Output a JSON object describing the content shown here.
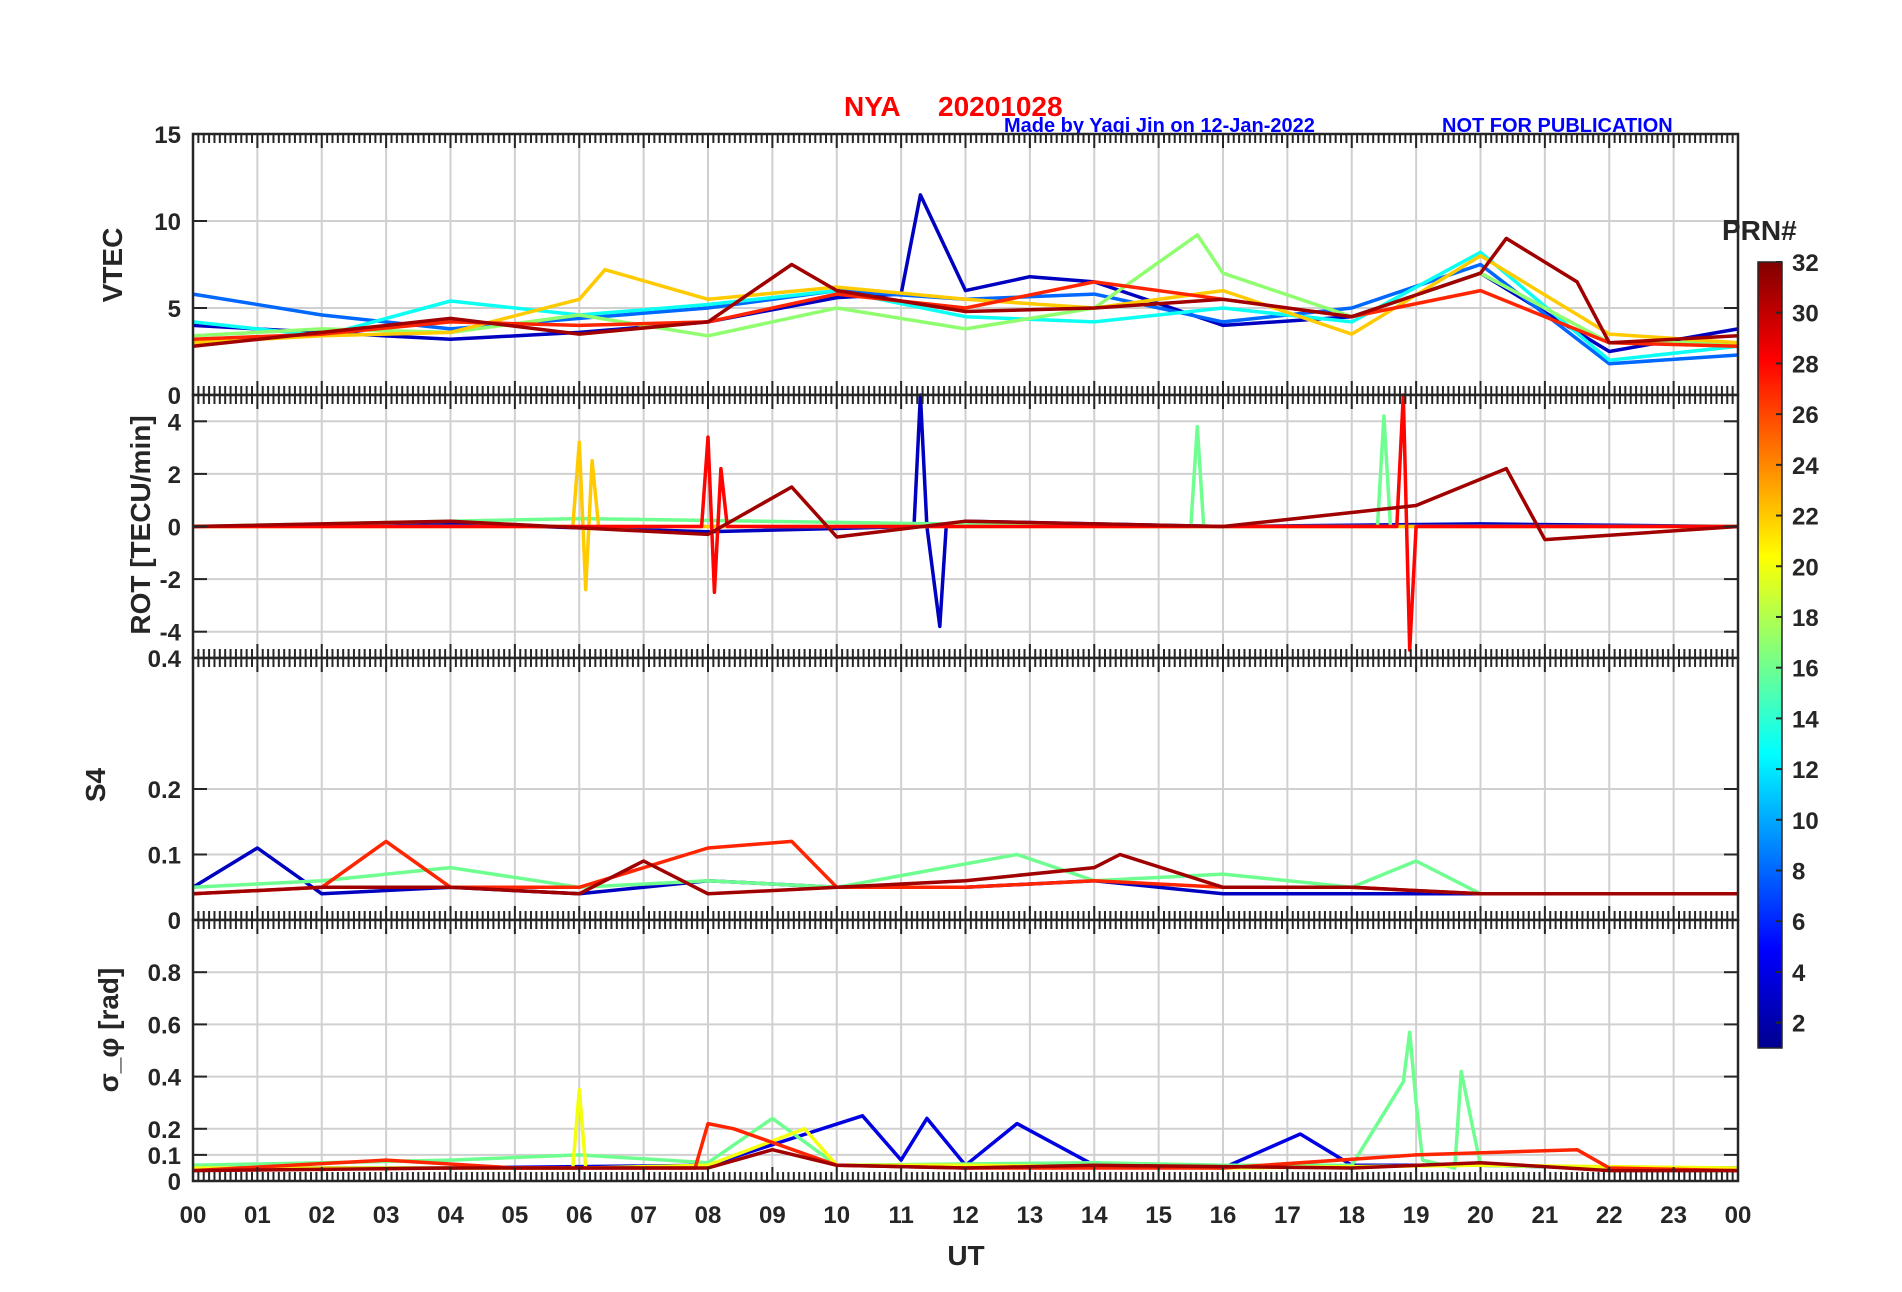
{
  "title": {
    "station": "NYA",
    "date": "20201028",
    "credit": "Made by Yaqi Jin on 12-Jan-2022",
    "notice": "NOT FOR PUBLICATION",
    "title_color": "#ff0000",
    "note_color": "#0000ff"
  },
  "x_axis": {
    "label": "UT",
    "range": [
      0,
      24
    ],
    "tick_labels": [
      "00",
      "01",
      "02",
      "03",
      "04",
      "05",
      "06",
      "07",
      "08",
      "09",
      "10",
      "11",
      "12",
      "13",
      "14",
      "15",
      "16",
      "17",
      "18",
      "19",
      "20",
      "21",
      "22",
      "23",
      "00"
    ]
  },
  "colorbar": {
    "title": "PRN#",
    "range": [
      1,
      32
    ],
    "colormap": "jet",
    "tick_labels": [
      "2",
      "4",
      "6",
      "8",
      "10",
      "12",
      "14",
      "16",
      "18",
      "20",
      "22",
      "24",
      "26",
      "28",
      "30",
      "32"
    ]
  },
  "chart_data": [
    {
      "type": "line",
      "panel": "VTEC",
      "ylabel": "VTEC",
      "ylim": [
        0,
        15
      ],
      "y_ticks": [
        0,
        5,
        10,
        15
      ],
      "y_tick_labels": [
        "0",
        "5",
        "10",
        "15"
      ],
      "grid": true,
      "series_by_prn": [
        {
          "prn": 3,
          "x": [
            0,
            2,
            4,
            6,
            8,
            10,
            11,
            11.3,
            12,
            13,
            14,
            16,
            18,
            20,
            22,
            24
          ],
          "y": [
            4,
            3.6,
            3.2,
            3.6,
            4.2,
            5.6,
            5.8,
            11.5,
            6,
            6.8,
            6.5,
            4,
            4.5,
            7,
            2.5,
            3.8
          ]
        },
        {
          "prn": 8,
          "x": [
            0,
            2,
            4,
            6,
            8,
            10,
            12,
            14,
            16,
            18,
            20,
            22,
            24
          ],
          "y": [
            5.8,
            4.6,
            3.8,
            4.4,
            5,
            6,
            5.5,
            5.8,
            4.2,
            5,
            7.5,
            1.8,
            2.3
          ]
        },
        {
          "prn": 13,
          "x": [
            0,
            2,
            4,
            6,
            8,
            10,
            12,
            14,
            16,
            18,
            20,
            22,
            24
          ],
          "y": [
            4.2,
            3.4,
            5.4,
            4.6,
            5.2,
            6,
            4.5,
            4.2,
            5,
            4.2,
            8.2,
            2,
            2.8
          ]
        },
        {
          "prn": 17,
          "x": [
            0,
            2,
            4,
            6,
            8,
            10,
            12,
            14,
            15.6,
            16,
            18,
            20,
            22,
            24
          ],
          "y": [
            3.4,
            3.8,
            3.6,
            4.6,
            3.4,
            5,
            3.8,
            5,
            9.2,
            7,
            4.5,
            7,
            3,
            3
          ]
        },
        {
          "prn": 22,
          "x": [
            0,
            2,
            4,
            6,
            6.4,
            8,
            10,
            12,
            14,
            16,
            18,
            20,
            22,
            24
          ],
          "y": [
            3,
            3.4,
            3.6,
            5.5,
            7.2,
            5.5,
            6.2,
            5.5,
            5,
            6,
            3.5,
            8,
            3.5,
            3
          ]
        },
        {
          "prn": 27,
          "x": [
            0,
            2,
            4,
            6,
            8,
            10,
            12,
            14,
            16,
            18,
            20,
            22,
            24
          ],
          "y": [
            3.2,
            3.5,
            4.2,
            4,
            4.2,
            5.8,
            5,
            6.5,
            5.5,
            4.5,
            6,
            3,
            2.8
          ]
        },
        {
          "prn": 31,
          "x": [
            0,
            2,
            4,
            6,
            8,
            9.3,
            10,
            12,
            14,
            16,
            18,
            20,
            20.4,
            21.5,
            22,
            24
          ],
          "y": [
            2.8,
            3.6,
            4.4,
            3.5,
            4.2,
            7.5,
            6,
            4.8,
            5,
            5.5,
            4.5,
            7,
            9,
            6.5,
            3,
            3.4
          ]
        }
      ]
    },
    {
      "type": "line",
      "panel": "ROT",
      "ylabel": "ROT [TECU/min]",
      "ylim": [
        -5,
        5
      ],
      "y_ticks": [
        -4,
        -2,
        0,
        2,
        4
      ],
      "y_tick_labels": [
        "-4",
        "-2",
        "0",
        "2",
        "4"
      ],
      "grid": true,
      "series_by_prn": [
        {
          "prn": 3,
          "x": [
            0,
            4,
            8,
            11.2,
            11.3,
            11.4,
            11.6,
            11.7,
            12,
            16,
            20,
            24
          ],
          "y": [
            0,
            0.1,
            -0.2,
            0,
            5,
            0,
            -3.8,
            0,
            0.2,
            0,
            0.1,
            0
          ]
        },
        {
          "prn": 16,
          "x": [
            0,
            6,
            14.4,
            15.5,
            15.6,
            15.7,
            18.4,
            18.5,
            18.6,
            24
          ],
          "y": [
            0,
            0.3,
            0,
            0,
            3.8,
            0,
            0,
            4.2,
            0,
            0
          ]
        },
        {
          "prn": 22,
          "x": [
            0,
            5.9,
            6,
            6.1,
            6.2,
            6.3,
            12,
            24
          ],
          "y": [
            0,
            0,
            3.2,
            -2.4,
            2.5,
            0,
            0,
            0
          ]
        },
        {
          "prn": 28,
          "x": [
            0,
            7.9,
            8,
            8.1,
            8.2,
            8.3,
            18.7,
            18.8,
            18.9,
            19,
            24
          ],
          "y": [
            0,
            0,
            3.4,
            -2.5,
            2.2,
            0,
            0,
            5,
            -4.7,
            0,
            0
          ]
        },
        {
          "prn": 31,
          "x": [
            0,
            4,
            8,
            9.3,
            10,
            12,
            16,
            19,
            20.4,
            21,
            24
          ],
          "y": [
            0,
            0.2,
            -0.3,
            1.5,
            -0.4,
            0.2,
            0,
            0.8,
            2.2,
            -0.5,
            0
          ]
        }
      ]
    },
    {
      "type": "line",
      "panel": "S4",
      "ylabel": "S4",
      "ylim": [
        0,
        0.4
      ],
      "y_ticks": [
        0,
        0.1,
        0.2,
        0.4
      ],
      "y_tick_labels": [
        "0",
        "0.1",
        "0.2",
        "0.4"
      ],
      "grid": true,
      "series_by_prn": [
        {
          "prn": 3,
          "x": [
            0,
            1,
            2,
            4,
            6,
            8,
            10,
            12,
            14,
            16,
            18,
            20,
            22,
            24
          ],
          "y": [
            0.05,
            0.11,
            0.04,
            0.05,
            0.04,
            0.06,
            0.05,
            0.05,
            0.06,
            0.04,
            0.04,
            0.04,
            0.04,
            0.04
          ]
        },
        {
          "prn": 16,
          "x": [
            0,
            2,
            4,
            6,
            8,
            10,
            12.8,
            14,
            16,
            18,
            19,
            20,
            22,
            24
          ],
          "y": [
            0.05,
            0.06,
            0.08,
            0.05,
            0.06,
            0.05,
            0.1,
            0.06,
            0.07,
            0.05,
            0.09,
            0.04,
            0.04,
            0.04
          ]
        },
        {
          "prn": 27,
          "x": [
            0,
            2,
            3,
            4,
            6,
            8,
            9.3,
            10,
            12,
            14,
            16,
            18,
            20,
            22,
            24
          ],
          "y": [
            0.04,
            0.05,
            0.12,
            0.05,
            0.05,
            0.11,
            0.12,
            0.05,
            0.05,
            0.06,
            0.05,
            0.05,
            0.04,
            0.04,
            0.04
          ]
        },
        {
          "prn": 31,
          "x": [
            0,
            2,
            4,
            6,
            7,
            8,
            10,
            12,
            14,
            14.4,
            16,
            18,
            20,
            22,
            24
          ],
          "y": [
            0.04,
            0.05,
            0.05,
            0.04,
            0.09,
            0.04,
            0.05,
            0.06,
            0.08,
            0.1,
            0.05,
            0.05,
            0.04,
            0.04,
            0.04
          ]
        }
      ]
    },
    {
      "type": "line",
      "panel": "sigma_phi",
      "ylabel": "σ_φ [rad]",
      "ylim": [
        0,
        1
      ],
      "y_ticks": [
        0,
        0.1,
        0.2,
        0.4,
        0.6,
        0.8
      ],
      "y_tick_labels": [
        "0",
        "0.1",
        "0.2",
        "0.4",
        "0.6",
        "0.8"
      ],
      "grid": true,
      "series_by_prn": [
        {
          "prn": 4,
          "x": [
            0,
            4,
            8,
            10.4,
            11,
            11.4,
            12,
            12.8,
            14,
            16,
            17.2,
            18,
            20,
            22,
            24
          ],
          "y": [
            0.05,
            0.05,
            0.06,
            0.25,
            0.08,
            0.24,
            0.06,
            0.22,
            0.06,
            0.05,
            0.18,
            0.06,
            0.06,
            0.05,
            0.05
          ]
        },
        {
          "prn": 16,
          "x": [
            0,
            4,
            6,
            8,
            9,
            10,
            14,
            16,
            18,
            18.8,
            18.9,
            19,
            19.1,
            19.6,
            19.7,
            20,
            22,
            24
          ],
          "y": [
            0.06,
            0.08,
            0.1,
            0.07,
            0.24,
            0.06,
            0.07,
            0.06,
            0.06,
            0.38,
            0.57,
            0.3,
            0.08,
            0.05,
            0.42,
            0.06,
            0.05,
            0.04
          ]
        },
        {
          "prn": 20,
          "x": [
            0,
            5.9,
            6,
            6.1,
            8,
            9.5,
            10,
            12,
            16,
            20,
            24
          ],
          "y": [
            0.05,
            0.05,
            0.35,
            0.05,
            0.06,
            0.2,
            0.06,
            0.06,
            0.05,
            0.06,
            0.05
          ]
        },
        {
          "prn": 27,
          "x": [
            0,
            3,
            5,
            7.8,
            8,
            8.4,
            10,
            12,
            16,
            19,
            21.5,
            22,
            24
          ],
          "y": [
            0.04,
            0.08,
            0.05,
            0.05,
            0.22,
            0.2,
            0.06,
            0.05,
            0.05,
            0.1,
            0.12,
            0.05,
            0.04
          ]
        },
        {
          "prn": 31,
          "x": [
            0,
            4,
            8,
            9,
            10,
            12,
            14,
            18,
            20,
            22,
            24
          ],
          "y": [
            0.04,
            0.05,
            0.05,
            0.12,
            0.06,
            0.05,
            0.06,
            0.05,
            0.07,
            0.04,
            0.04
          ]
        }
      ]
    }
  ]
}
